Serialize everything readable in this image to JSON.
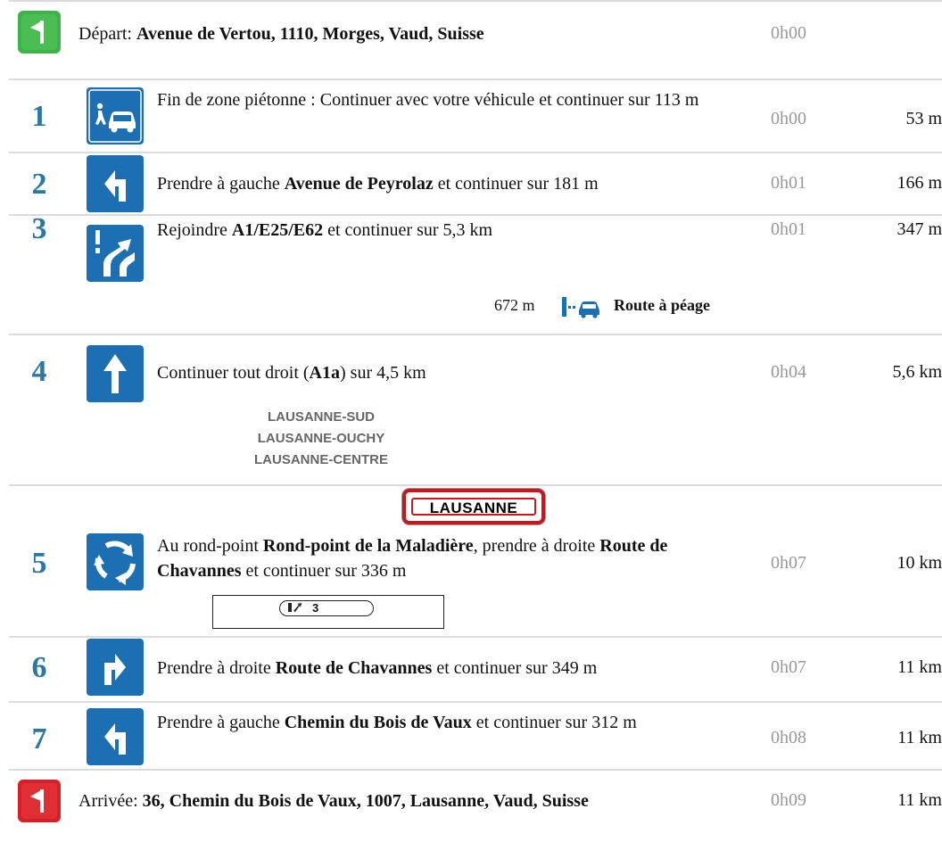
{
  "start": {
    "label": "Départ:",
    "address": "Avenue de Vertou, 1110, Morges, Vaud, Suisse",
    "time": "0h00",
    "flag_color": "#3fb34a"
  },
  "steps": [
    {
      "number": "1",
      "icon": "pedestrian-zone-end-icon",
      "text_parts": [
        "Fin de zone piétonne : Continuer avec votre véhicule et continuer sur 113 m"
      ],
      "time": "0h00",
      "distance": "53 m"
    },
    {
      "number": "2",
      "icon": "turn-left-icon",
      "prefix": "Prendre à gauche",
      "road": "Avenue de Peyrolaz",
      "suffix": "et continuer sur 181 m",
      "time": "0h01",
      "distance": "166 m"
    },
    {
      "number": "3",
      "icon": "merge-icon",
      "prefix": "Rejoindre",
      "road": "A1/E25/E62",
      "suffix": "et continuer sur 5,3 km",
      "time": "0h01",
      "distance": "347 m",
      "toll": {
        "distance": "672 m",
        "icon": "toll-road-icon",
        "label": "Route à péage"
      }
    },
    {
      "number": "4",
      "icon": "straight-arrow-icon",
      "prefix": "Continuer tout droit (",
      "road": "A1a",
      "suffix": ") sur 4,5 km",
      "time": "0h04",
      "distance": "5,6 km",
      "directions": [
        "LAUSANNE-SUD",
        "LAUSANNE-OUCHY",
        "LAUSANNE-CENTRE"
      ]
    },
    {
      "number": "5",
      "icon": "roundabout-icon",
      "sign": "LAUSANNE",
      "prefix": "Au rond-point",
      "road": "Rond-point de la Maladière",
      "middle": ", prendre à droite",
      "road2": "Route de Chavannes",
      "suffix": "et continuer sur 336 m",
      "time": "0h07",
      "distance": "10 km",
      "exit_number": "3"
    },
    {
      "number": "6",
      "icon": "turn-right-icon",
      "prefix": "Prendre à droite",
      "road": "Route de Chavannes",
      "suffix": "et continuer sur 349 m",
      "time": "0h07",
      "distance": "11 km"
    },
    {
      "number": "7",
      "icon": "turn-left-icon",
      "prefix": "Prendre à gauche",
      "road": "Chemin du Bois de Vaux",
      "suffix": "et continuer sur 312 m",
      "time": "0h08",
      "distance": "11 km"
    }
  ],
  "arrival": {
    "label": "Arrivée:",
    "address": "36, Chemin du Bois de Vaux, 1007, Lausanne, Vaud, Suisse",
    "time": "0h09",
    "distance": "11 km",
    "flag_color": "#d62027"
  },
  "colors": {
    "step_number": "#2b78a6",
    "icon_blue": "#1d6fb3",
    "time_gray": "#999999",
    "separator": "#dcdcdc"
  }
}
